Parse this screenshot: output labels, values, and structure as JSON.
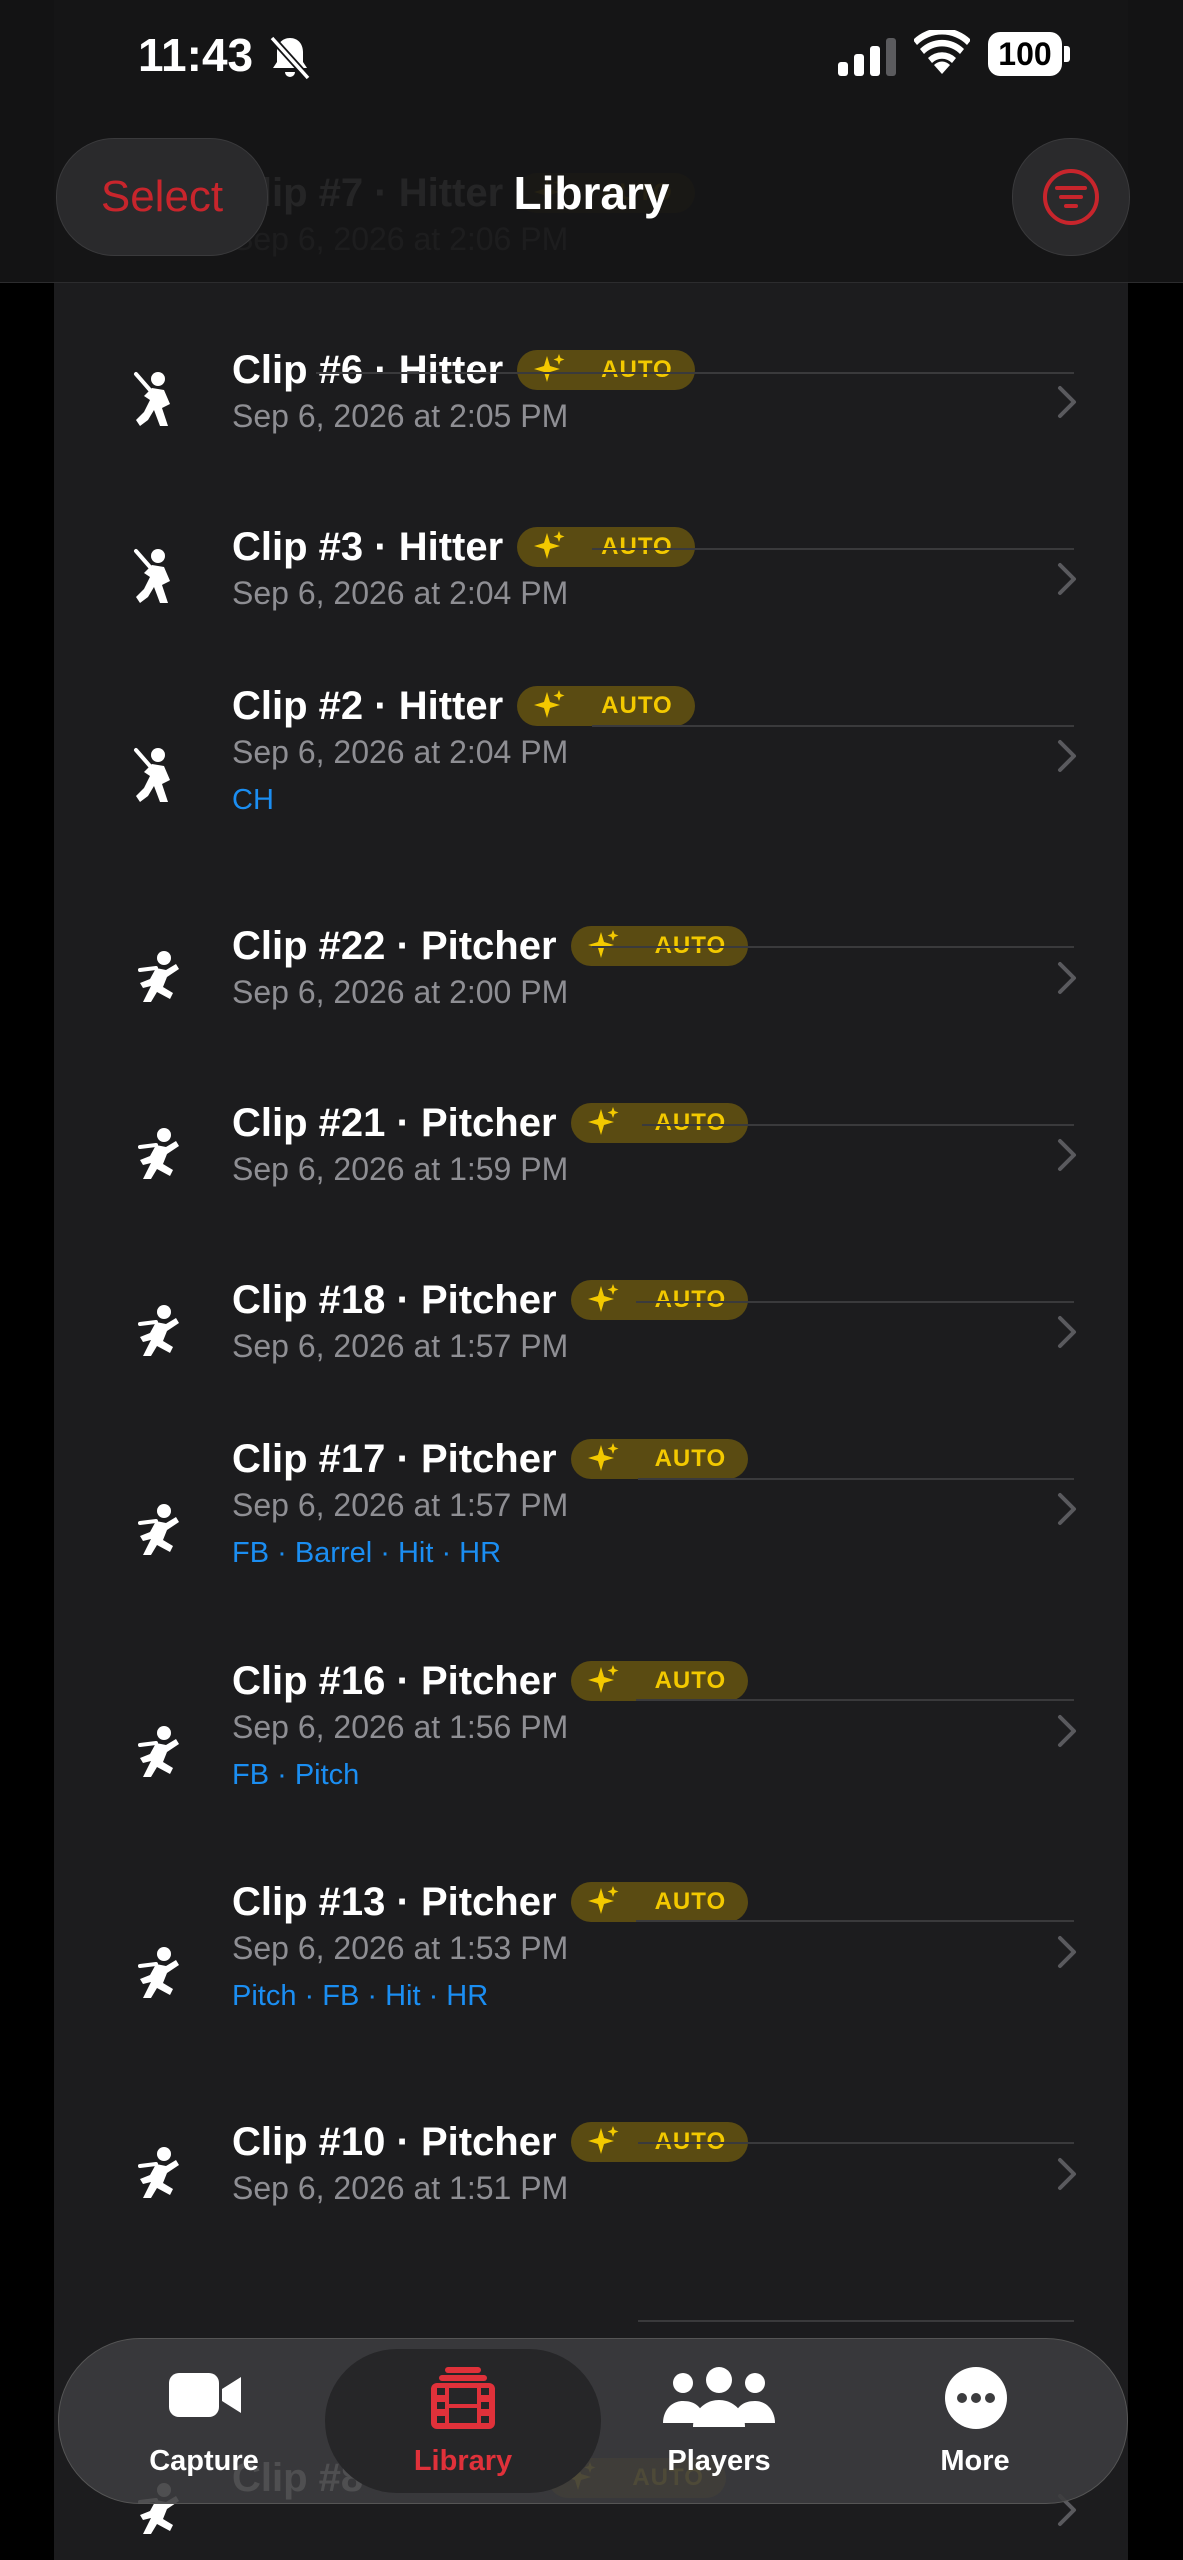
{
  "status_bar": {
    "time": "11:43",
    "battery": "100"
  },
  "nav": {
    "title": "Library",
    "select_label": "Select"
  },
  "colors": {
    "accent": "#e0313a",
    "badge_text": "#f3c900",
    "badge_bg": "#5a4b12",
    "tag": "#1b8ef2"
  },
  "clips": [
    {
      "title": "Clip #7 · Hitter",
      "badge": "AUTO",
      "date": "Sep 6, 2026 at 2:06 PM",
      "tags": "",
      "role": "hitter"
    },
    {
      "title": "Clip #6 · Hitter",
      "badge": "AUTO",
      "date": "Sep 6, 2026 at 2:05 PM",
      "tags": "",
      "role": "hitter"
    },
    {
      "title": "Clip #3 · Hitter",
      "badge": "AUTO",
      "date": "Sep 6, 2026 at 2:04 PM",
      "tags": "",
      "role": "hitter"
    },
    {
      "title": "Clip #2 · Hitter",
      "badge": "AUTO",
      "date": "Sep 6, 2026 at 2:04 PM",
      "tags": "CH",
      "role": "hitter"
    },
    {
      "title": "Clip #22 · Pitcher",
      "badge": "AUTO",
      "date": "Sep 6, 2026 at 2:00 PM",
      "tags": "",
      "role": "pitcher"
    },
    {
      "title": "Clip #21 · Pitcher",
      "badge": "AUTO",
      "date": "Sep 6, 2026 at 1:59 PM",
      "tags": "",
      "role": "pitcher"
    },
    {
      "title": "Clip #18 · Pitcher",
      "badge": "AUTO",
      "date": "Sep 6, 2026 at 1:57 PM",
      "tags": "",
      "role": "pitcher"
    },
    {
      "title": "Clip #17 · Pitcher",
      "badge": "AUTO",
      "date": "Sep 6, 2026 at 1:57 PM",
      "tags": "FB · Barrel · Hit · HR",
      "role": "pitcher"
    },
    {
      "title": "Clip #16 · Pitcher",
      "badge": "AUTO",
      "date": "Sep 6, 2026 at 1:56 PM",
      "tags": "FB · Pitch",
      "role": "pitcher"
    },
    {
      "title": "Clip #13 · Pitcher",
      "badge": "AUTO",
      "date": "Sep 6, 2026 at 1:53 PM",
      "tags": "Pitch · FB · Hit · HR",
      "role": "pitcher"
    },
    {
      "title": "Clip #10 · Pitcher",
      "badge": "AUTO",
      "date": "Sep 6, 2026 at 1:51 PM",
      "tags": "",
      "role": "pitcher"
    },
    {
      "title": "Clip #8 · Pitcher",
      "badge": "AUTO",
      "date": "",
      "tags": "",
      "role": "pitcher"
    }
  ],
  "tabbar": {
    "tabs": [
      {
        "label": "Capture",
        "icon": "video-camera-icon"
      },
      {
        "label": "Library",
        "icon": "film-reel-icon",
        "active": true
      },
      {
        "label": "Players",
        "icon": "people-icon"
      },
      {
        "label": "More",
        "icon": "ellipsis-icon"
      }
    ]
  }
}
